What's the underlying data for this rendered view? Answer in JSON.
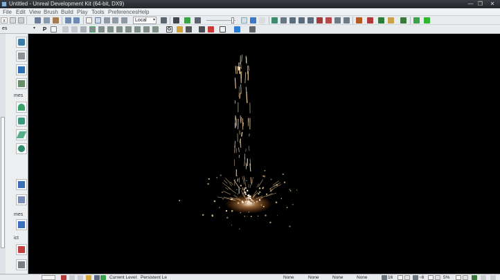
{
  "window": {
    "title": "Untitled - Unreal Development Kit (64-bit, DX9)",
    "minimize_glyph": "—",
    "maximize_glyph": "❐",
    "close_glyph": "✕"
  },
  "menu": {
    "items": [
      "File",
      "Edit",
      "View",
      "Brush",
      "Build",
      "Play",
      "Tools",
      "Preferences",
      "Help"
    ]
  },
  "toolbar": {
    "tab_close_glyph": "x",
    "coord_space": "Local",
    "combo_arrow": "▾",
    "p_label": "P",
    "g_label": "G"
  },
  "palette": {
    "sections": [
      "es",
      "mes",
      "mes",
      "ict"
    ]
  },
  "statusbar": {
    "current_level_label": "Current Level:",
    "current_level_value": "Persistent Le",
    "fields": [
      "None",
      "None",
      "None",
      "None"
    ],
    "grid_value": "16",
    "rot_value": "~6",
    "scale_value": "5%"
  },
  "colors": {
    "accent_green": "#3aa34a",
    "play_green": "#2fb82f",
    "spark": "#ffd9a0",
    "spark_core": "#fff4e0"
  }
}
